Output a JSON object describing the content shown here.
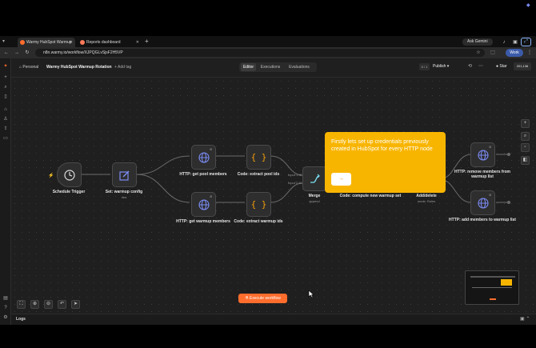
{
  "browser": {
    "tabs": [
      {
        "title": "Warmy HubSpot Warmup",
        "active": true,
        "favicon_color": "#ff6d2d"
      },
      {
        "title": "Reports dashboard",
        "active": false,
        "favicon_color": "#ff7a59"
      }
    ],
    "new_tab": "+",
    "url": "n8n.warmy.io/workflow/XJPQGLvSjsF2H5VP",
    "ask_gemini": "Ask Gemini",
    "profile_badge": "Work"
  },
  "header": {
    "breadcrumb_owner": "Personal",
    "workflow_name": "Warmy HubSpot Warmup Rotation",
    "add_tag": "+ Add tag",
    "tabs": [
      "Editor",
      "Executions",
      "Evaluations"
    ],
    "active_tab": "Editor",
    "counter": "0 / 1",
    "publish": "Publish",
    "star_label": "Star",
    "star_count": "201,136"
  },
  "nodes": {
    "schedule": {
      "label": "Schedule Trigger"
    },
    "setconfig": {
      "label": "Set: warmup config",
      "sub": "raw"
    },
    "getpool": {
      "label": "HTTP: get pool members"
    },
    "getwarmup": {
      "label": "HTTP: get warmup members"
    },
    "extractpool": {
      "label": "Code: extract pool ids"
    },
    "extractwarmup": {
      "label": "Code: extract warmup ids"
    },
    "merge": {
      "label": "Merge",
      "sub": "append",
      "input1": "Input 1 ID",
      "input2": "Input 2 ID"
    },
    "compute": {
      "label": "Code: compute new warmup set"
    },
    "adddelete": {
      "label": "Add/delete",
      "sub": "mode: Rules"
    },
    "remove": {
      "label": "HTTP: remove members from warmup list"
    },
    "addmembers": {
      "label": "HTTP: add members to warmup list"
    }
  },
  "tooltip": {
    "text": "Firstly lets set up credentials previously created in HubSpot for every HTTP node",
    "button": "→"
  },
  "execute_button": "Execute workflow",
  "logs_label": "Logs",
  "colors": {
    "accent": "#ff6d2d",
    "tooltip": "#f8b500",
    "http": "#7b8cf5",
    "code": "#f59e0b"
  }
}
